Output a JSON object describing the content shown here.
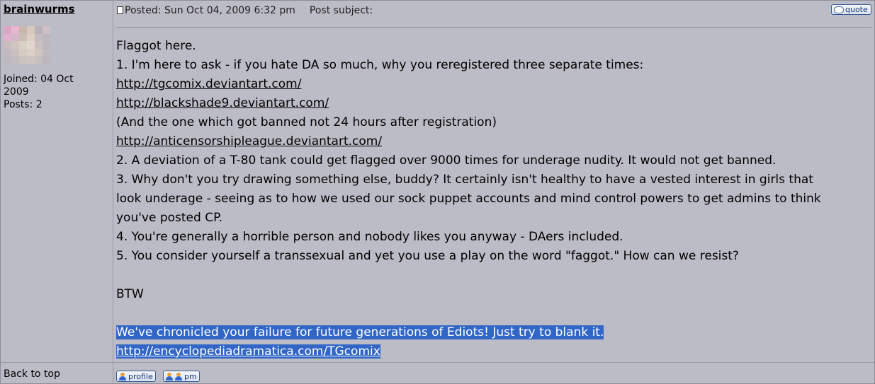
{
  "user": {
    "name": "brainwurms",
    "joined": "Joined: 04 Oct\n2009",
    "posts": "Posts: 2"
  },
  "post": {
    "posted": "Posted: Sun Oct 04, 2009 6:32 pm",
    "subject_label": "Post subject:",
    "quote_label": "quote",
    "body_lines": [
      "Flaggot here.",
      "1. I'm here to ask - if you hate DA so much, why you reregistered three separate times:",
      "http://tgcomix.deviantart.com/",
      "http://blackshade9.deviantart.com/",
      "(And the one which got banned not 24 hours after registration)",
      "http://anticensorshipleague.deviantart.com/",
      "2. A deviation of a T-80 tank could get flagged over 9000 times for underage nudity. It would not get banned.",
      "3. Why don't you try drawing something else, buddy? It certainly isn't healthy to have a vested interest in girls that",
      "look underage - seeing as to how we used our sock puppet accounts and mind control powers to get admins to think",
      "you've posted CP.",
      "4. You're generally a horrible person and nobody likes you anyway - DAers included.",
      "5. You consider yourself a transsexual and yet you use a play on the word \"faggot.\" How can we resist?",
      "",
      "BTW",
      "",
      "We've chronicled your failure for future generations of Ediots! Just try to blank it.",
      "http://encyclopediadramatica.com/TGcomix"
    ]
  },
  "footer": {
    "back_to_top": "Back to top",
    "profile_label": "profile",
    "pm_label": "pm"
  },
  "colors": {
    "background": "#bcbcc6",
    "selection": "#3166c7",
    "button_border": "#3b5e98"
  }
}
